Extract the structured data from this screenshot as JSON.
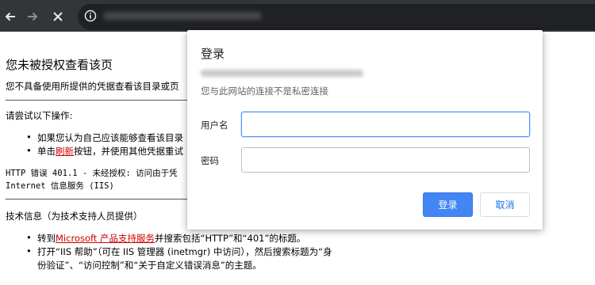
{
  "browser": {
    "back_icon": "arrow-left-icon",
    "forward_icon": "arrow-right-icon",
    "stop_icon": "close-icon",
    "site_info_icon": "info-icon"
  },
  "page": {
    "title": "您未被授权查看该页",
    "description": "您不具备使用所提供的凭据查看该目录或页",
    "try_heading": "请尝试以下操作:",
    "bullet1": "如果您认为自己应该能够查看该目录",
    "bullet2_prefix": "单击",
    "bullet2_link": "刷新",
    "bullet2_suffix": "按钮，并使用其他凭据重试",
    "error_line1": "HTTP 错误 401.1 - 未经授权: 访问由于凭",
    "error_line2": "Internet 信息服务 (IIS)",
    "tech_heading": "技术信息（为技术支持人员提供）",
    "tech1_prefix": "转到",
    "tech1_link": "Microsoft 产品支持服务",
    "tech1_suffix": "并搜索包括“HTTP”和“401”的标题。",
    "tech2_line1": "打开“IIS 帮助”（可在 IIS 管理器 (inetmgr) 中访问），然后搜索标题为“身",
    "tech2_line2": "份验证”、“访问控制”和“关于自定义错误消息”的主题。"
  },
  "dialog": {
    "title": "登录",
    "connection_note": "您与此网站的连接不是私密连接",
    "username_label": "用户名",
    "username_value": "",
    "password_label": "密码",
    "password_value": "",
    "login_button": "登录",
    "cancel_button": "取消",
    "accent_color": "#4285f4"
  }
}
